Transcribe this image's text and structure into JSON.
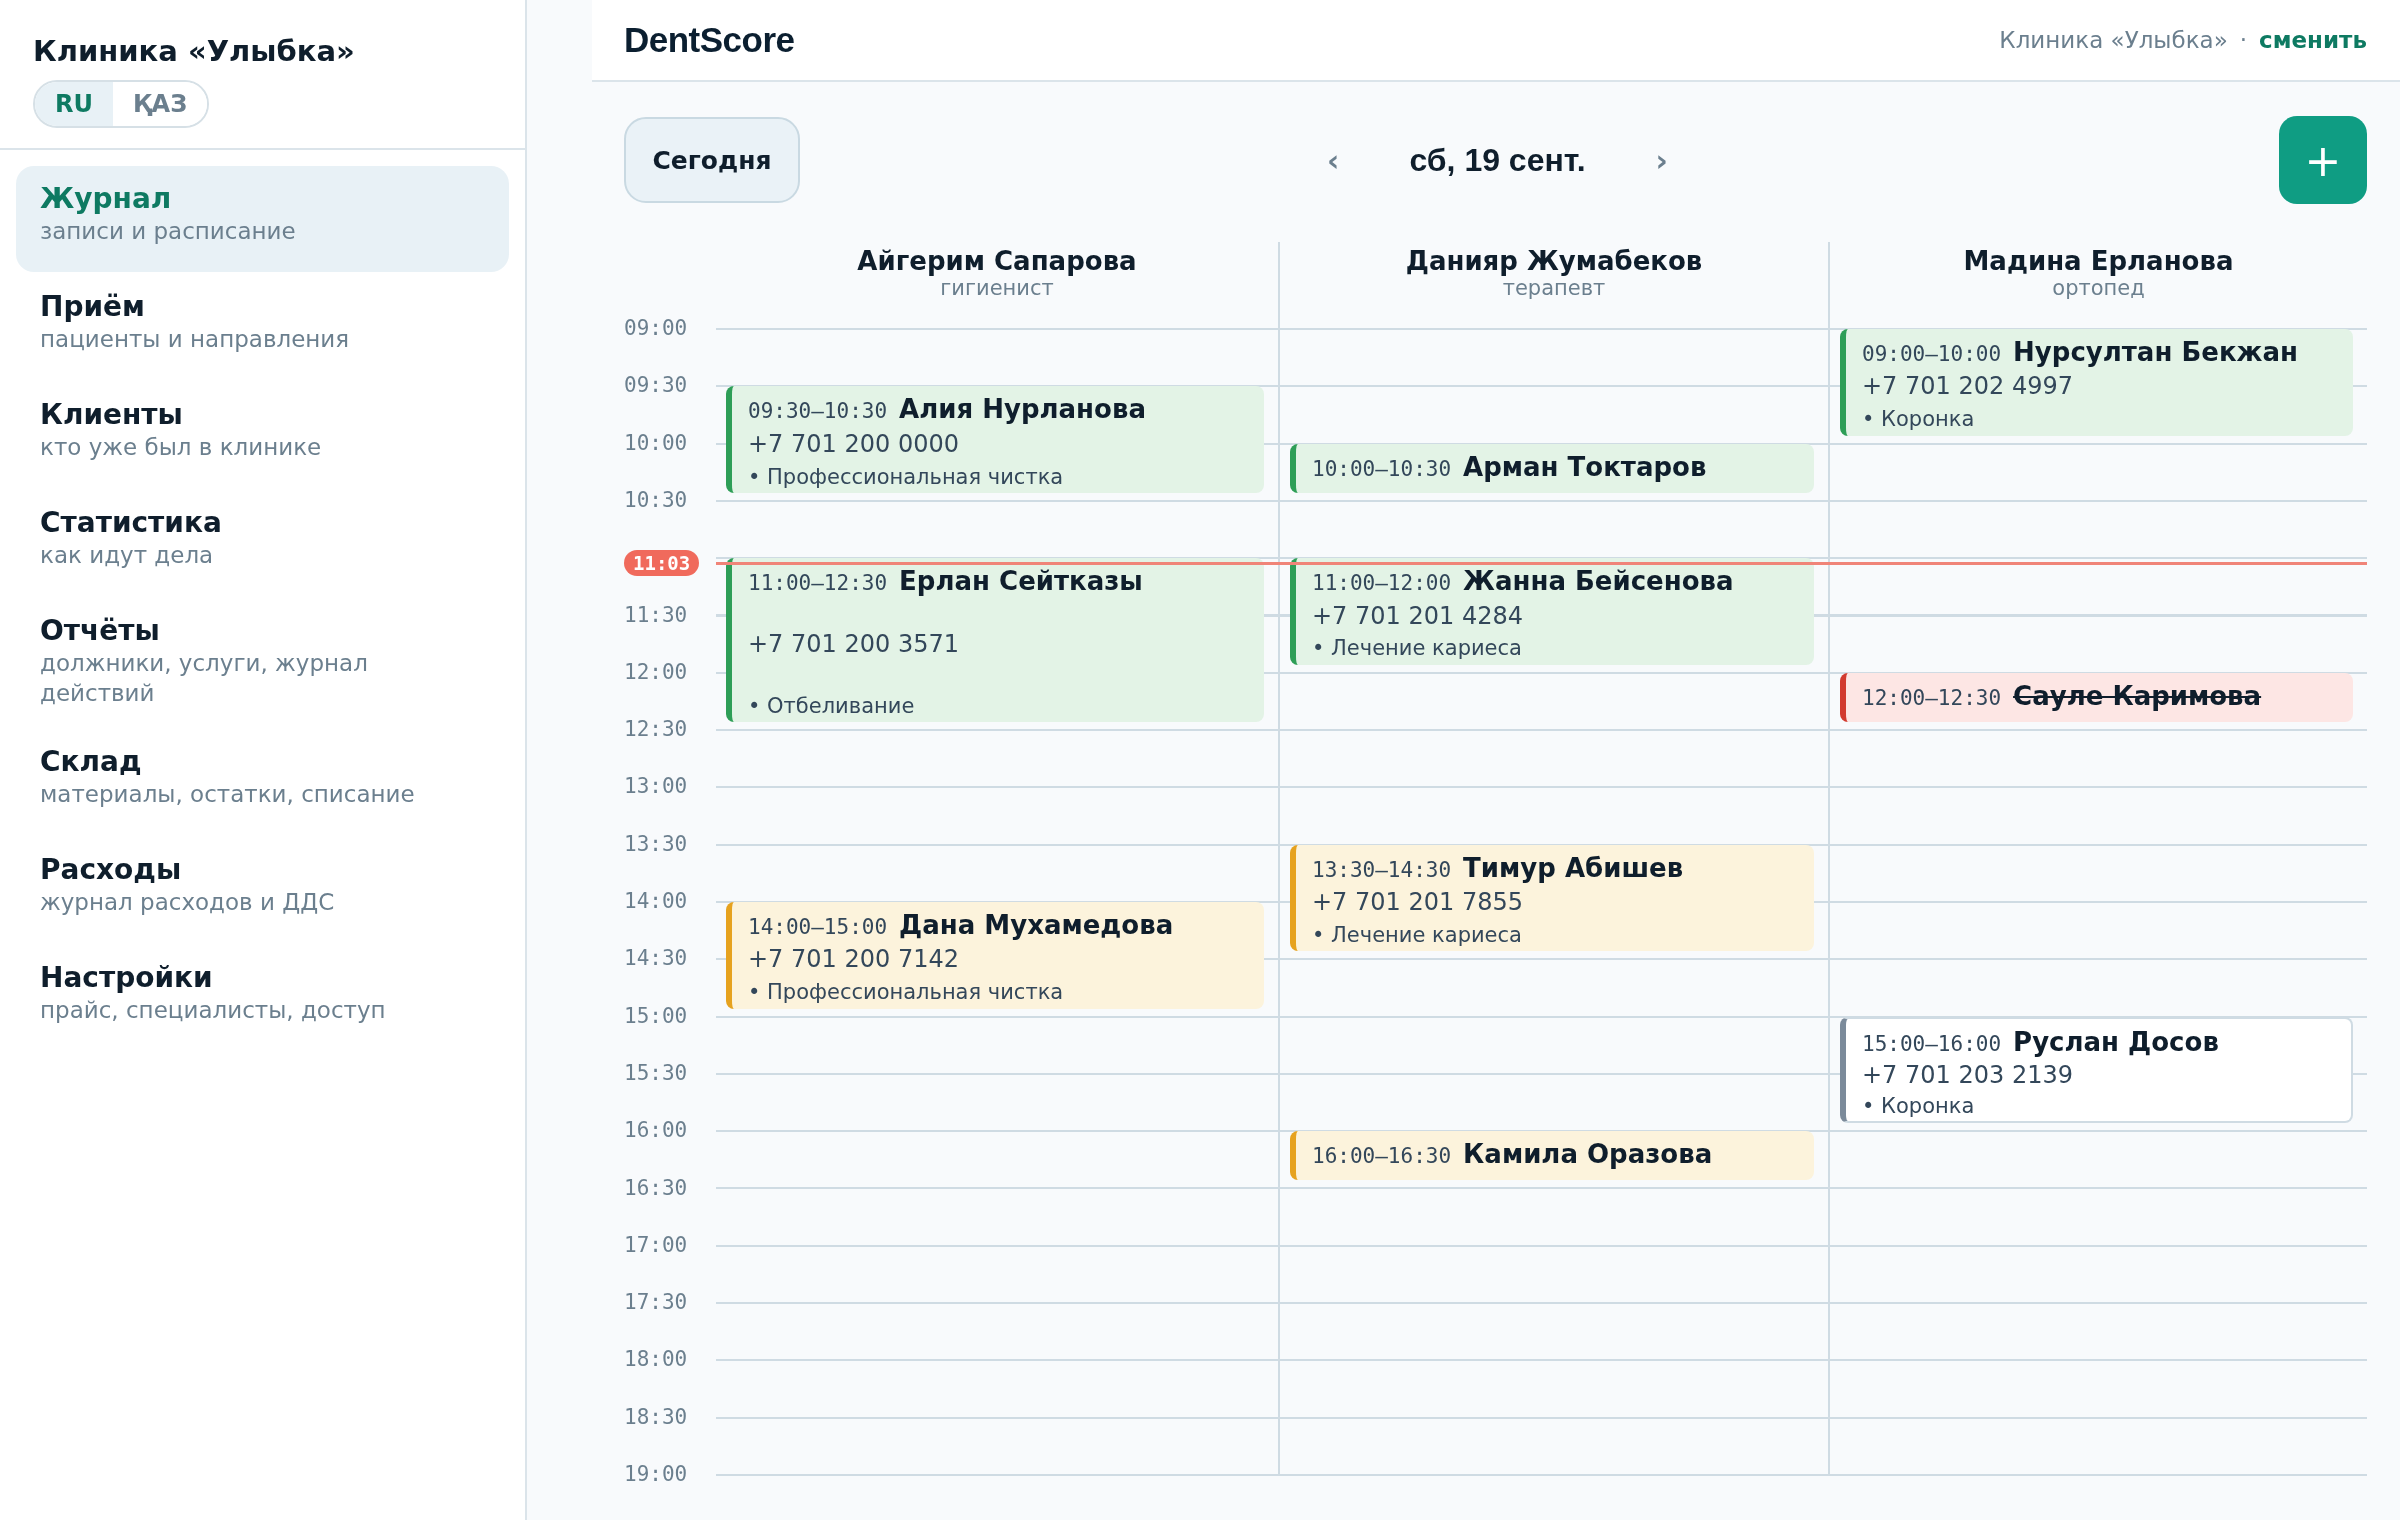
{
  "sidebar": {
    "clinic": "Клиника «Улыбка»",
    "languages": [
      {
        "label": "RU",
        "selected": true
      },
      {
        "label": "ҚАЗ",
        "selected": false
      }
    ],
    "items": [
      {
        "title": "Журнал",
        "subtitle": "записи и расписание",
        "selected": true
      },
      {
        "title": "Приём",
        "subtitle": "пациенты и направления",
        "selected": false
      },
      {
        "title": "Клиенты",
        "subtitle": "кто уже был в клинике",
        "selected": false
      },
      {
        "title": "Статистика",
        "subtitle": "как идут дела",
        "selected": false
      },
      {
        "title": "Отчёты",
        "subtitle": "должники, услуги, журнал действий",
        "selected": false
      },
      {
        "title": "Склад",
        "subtitle": "материалы, остатки, списание",
        "selected": false
      },
      {
        "title": "Расходы",
        "subtitle": "журнал расходов и ДДС",
        "selected": false
      },
      {
        "title": "Настройки",
        "subtitle": "прайс, специалисты, доступ",
        "selected": false
      }
    ]
  },
  "header": {
    "logo": "DentScore",
    "clinic": "Клиника «Улыбка»",
    "separator": "·",
    "switch_link": "сменить"
  },
  "toolbar": {
    "today": "Сегодня",
    "prev": "‹",
    "date": "сб, 19 сент.",
    "next": "›",
    "add": "+"
  },
  "schedule": {
    "times": [
      "09:00",
      "09:30",
      "10:00",
      "10:30",
      "11:30",
      "12:00",
      "12:30",
      "13:00",
      "13:30",
      "14:00",
      "14:30",
      "15:00",
      "15:30",
      "16:00",
      "16:30",
      "17:00",
      "17:30",
      "18:00",
      "18:30",
      "19:00"
    ],
    "now": "11:03",
    "columns": [
      {
        "name": "Айгерим Сапарова",
        "role": "гигиенист",
        "appointments": [
          {
            "kind": "confirmed",
            "time": "09:30–10:30",
            "patient": "Алия Нурланова",
            "phone": "+7 701 200 0000",
            "service": "• Профессиональная чистка"
          },
          {
            "kind": "confirmed",
            "time": "11:00–12:30",
            "patient": "Ерлан Сейтказы",
            "phone": "+7 701 200 3571",
            "service": "• Отбеливание"
          },
          {
            "kind": "pending",
            "time": "14:00–15:00",
            "patient": "Дана Мухамедова",
            "phone": "+7 701 200 7142",
            "service": "• Профессиональная чистка"
          }
        ]
      },
      {
        "name": "Данияр Жумабеков",
        "role": "терапевт",
        "appointments": [
          {
            "kind": "confirmed",
            "time": "10:00–10:30",
            "patient": "Арман Токтаров"
          },
          {
            "kind": "confirmed",
            "time": "11:00–12:00",
            "patient": "Жанна Бейсенова",
            "phone": "+7 701 201 4284",
            "service": "• Лечение кариеса"
          },
          {
            "kind": "pending",
            "time": "13:30–14:30",
            "patient": "Тимур Абишев",
            "phone": "+7 701 201 7855",
            "service": "• Лечение кариеса"
          },
          {
            "kind": "pending",
            "time": "16:00–16:30",
            "patient": "Камила Оразова"
          }
        ]
      },
      {
        "name": "Мадина Ерланова",
        "role": "ортопед",
        "appointments": [
          {
            "kind": "confirmed",
            "time": "09:00–10:00",
            "patient": "Нурсултан Бекжан",
            "phone": "+7 701 202 4997",
            "service": "• Коронка"
          },
          {
            "kind": "cancelled",
            "time": "12:00–12:30",
            "patient": "Сауле Каримова"
          },
          {
            "kind": "planned",
            "time": "15:00–16:00",
            "patient": "Руслан Досов",
            "phone": "+7 701 203 2139",
            "service": "• Коронка"
          }
        ]
      }
    ]
  }
}
